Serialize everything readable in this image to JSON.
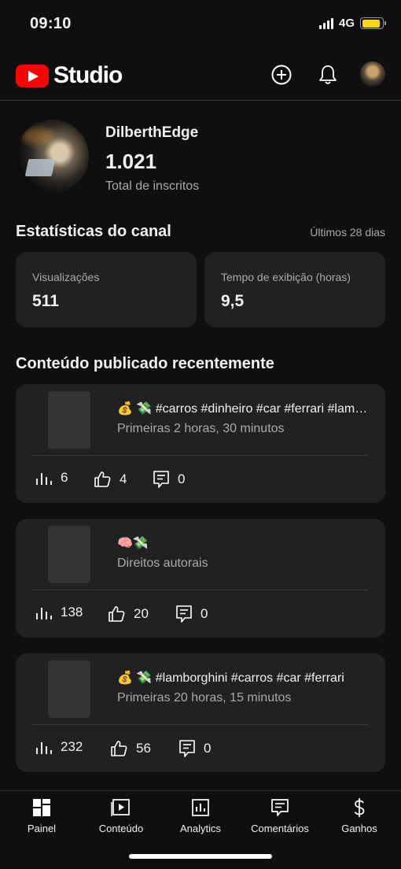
{
  "status_bar": {
    "time": "09:10",
    "network": "4G",
    "battery_level": 0.9
  },
  "header": {
    "app_name": "Studio",
    "icons": [
      "youtube-logo-icon",
      "create-icon",
      "notifications-icon",
      "account-avatar"
    ]
  },
  "channel": {
    "name": "DilberthEdge",
    "subscribers": "1.021",
    "subscribers_label": "Total de inscritos"
  },
  "stats": {
    "title": "Estatísticas do canal",
    "period": "Últimos 28 dias",
    "cards": [
      {
        "label": "Visualizações",
        "value": "511"
      },
      {
        "label": "Tempo de exibição (horas)",
        "value": "9,5"
      }
    ]
  },
  "recent": {
    "title": "Conteúdo publicado recentemente",
    "items": [
      {
        "title": "💰 💸 #carros #dinheiro #car #ferrari #lamborghini",
        "subtitle": "Primeiras 2 horas, 30 minutos",
        "views": "6",
        "likes": "4",
        "comments": "0"
      },
      {
        "title": "🧠💸",
        "subtitle": "Direitos autorais",
        "views": "138",
        "likes": "20",
        "comments": "0"
      },
      {
        "title": "💰 💸 #lamborghini #carros #car #ferrari",
        "subtitle": "Primeiras 20 horas, 15 minutos",
        "views": "232",
        "likes": "56",
        "comments": "0"
      }
    ]
  },
  "nav": {
    "items": [
      {
        "label": "Painel",
        "icon": "dashboard-icon"
      },
      {
        "label": "Conteúdo",
        "icon": "content-icon"
      },
      {
        "label": "Analytics",
        "icon": "analytics-icon"
      },
      {
        "label": "Comentários",
        "icon": "comments-icon"
      },
      {
        "label": "Ganhos",
        "icon": "earn-icon"
      }
    ]
  },
  "colors": {
    "background": "#0f0f0f",
    "card": "#212121",
    "brand": "#ff0000",
    "battery": "#ffd60a"
  }
}
